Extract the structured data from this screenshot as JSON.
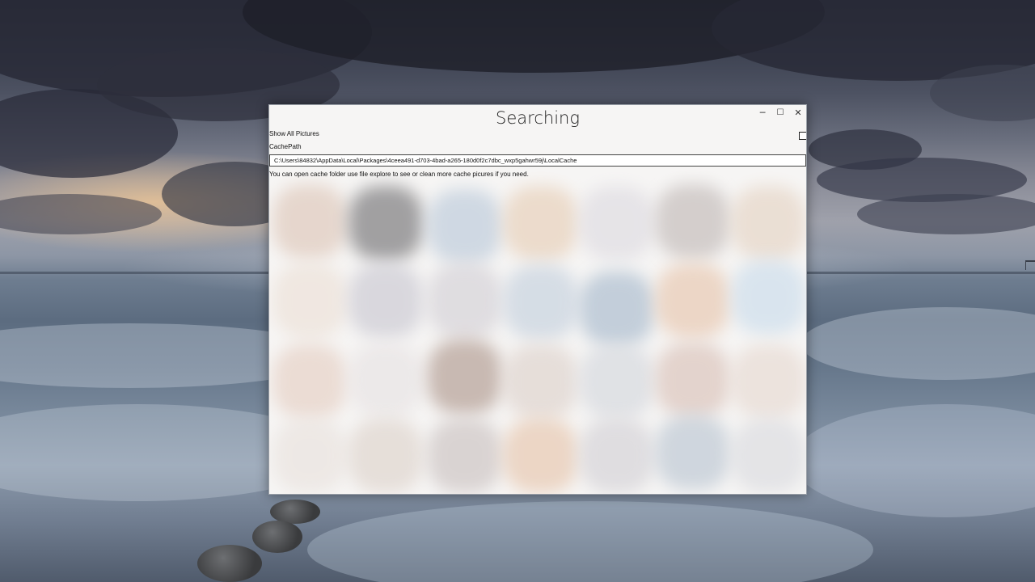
{
  "window": {
    "title": "Searching",
    "minimize_glyph": "─",
    "maximize_glyph": "☐",
    "close_glyph": "✕"
  },
  "toggle": {
    "label": "Show All Pictures",
    "checked": false
  },
  "cache": {
    "label": "CachePath",
    "path_value": "C:\\Users\\84832\\AppData\\Local\\Packages\\4ceea491-d703-4bad-a265-180d0f2c7dbc_wxp5gahwr59j\\LocalCache",
    "hint": "You can open cache folder use file explore to see or clean more cache picures if you need."
  },
  "colors": {
    "window_bg": "#f3f3f3",
    "text": "#111111"
  },
  "icons": [
    "minimize-icon",
    "maximize-icon",
    "close-icon"
  ]
}
